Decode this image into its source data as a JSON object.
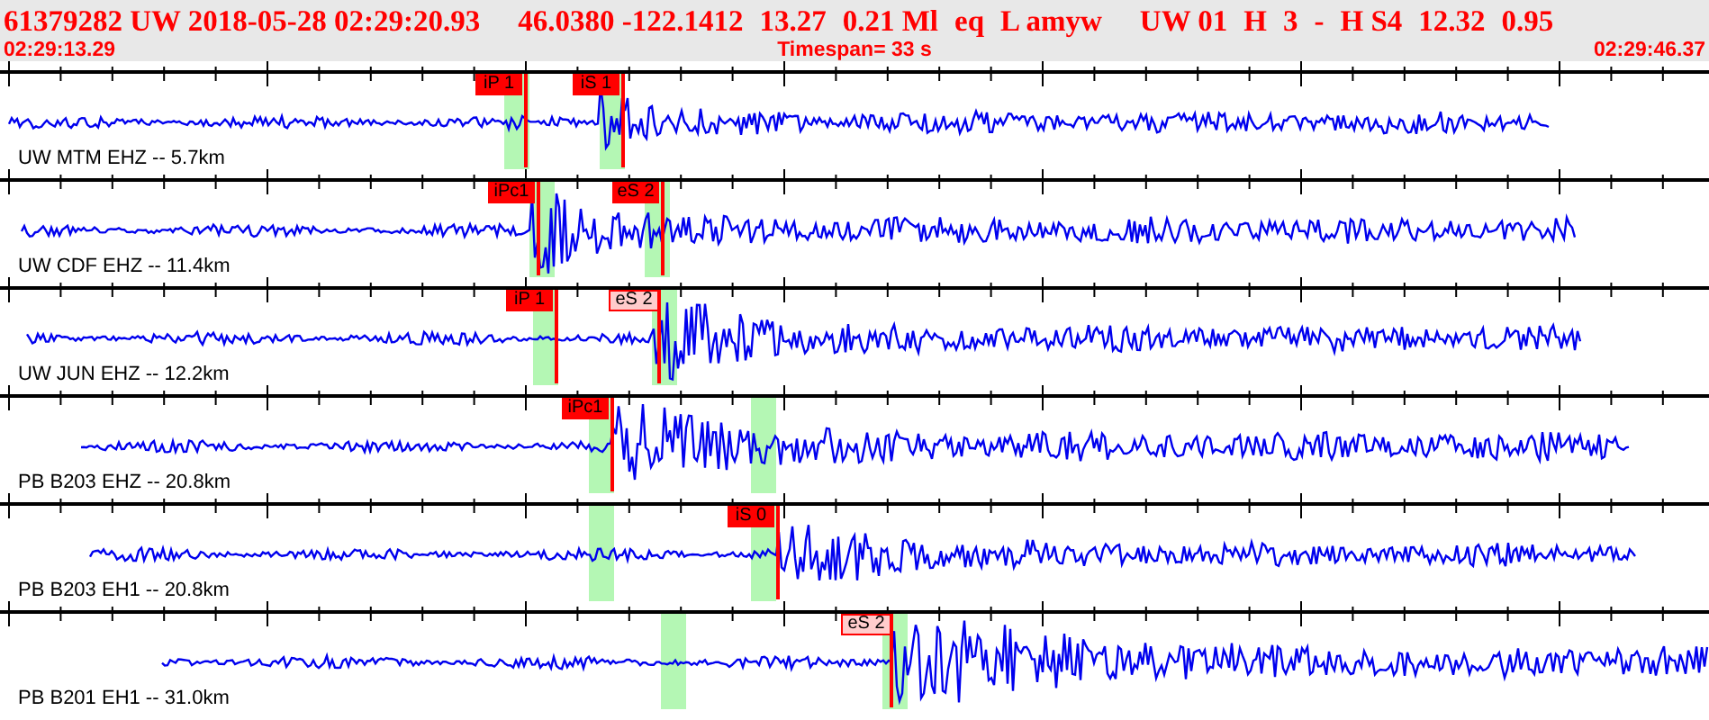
{
  "header": {
    "fields": [
      "61379282 UW 2018-05-28 02:29:20.93",
      "46.0380 -122.1412",
      "13.27",
      "0.21 Ml",
      "eq",
      "L amyw",
      "UW 01",
      "H",
      "3",
      "-",
      "H S4",
      "12.32",
      "0.95"
    ],
    "start_time": "02:29:13.29",
    "timespan": "Timespan=  33 s",
    "end_time": "02:29:46.37"
  },
  "traces": [
    {
      "station": "UW MTM EHZ -- 5.7km",
      "picks": [
        {
          "label": "iP 1",
          "kind": "solid"
        },
        {
          "label": "iS 1",
          "kind": "solid"
        }
      ]
    },
    {
      "station": "UW CDF EHZ -- 11.4km",
      "picks": [
        {
          "label": "iPc1",
          "kind": "solid"
        },
        {
          "label": "eS 2",
          "kind": "solid"
        }
      ]
    },
    {
      "station": "UW JUN EHZ -- 12.2km",
      "picks": [
        {
          "label": "iP 1",
          "kind": "solid"
        },
        {
          "label": "eS 2",
          "kind": "pale"
        }
      ]
    },
    {
      "station": "PB B203 EHZ -- 20.8km",
      "picks": [
        {
          "label": "iPc1",
          "kind": "solid"
        }
      ]
    },
    {
      "station": "PB B203 EH1 -- 20.8km",
      "picks": [
        {
          "label": "iS 0",
          "kind": "solid"
        }
      ]
    },
    {
      "station": "PB B201 EH1 -- 31.0km",
      "picks": [
        {
          "label": "eS 2",
          "kind": "pale"
        }
      ]
    }
  ]
}
